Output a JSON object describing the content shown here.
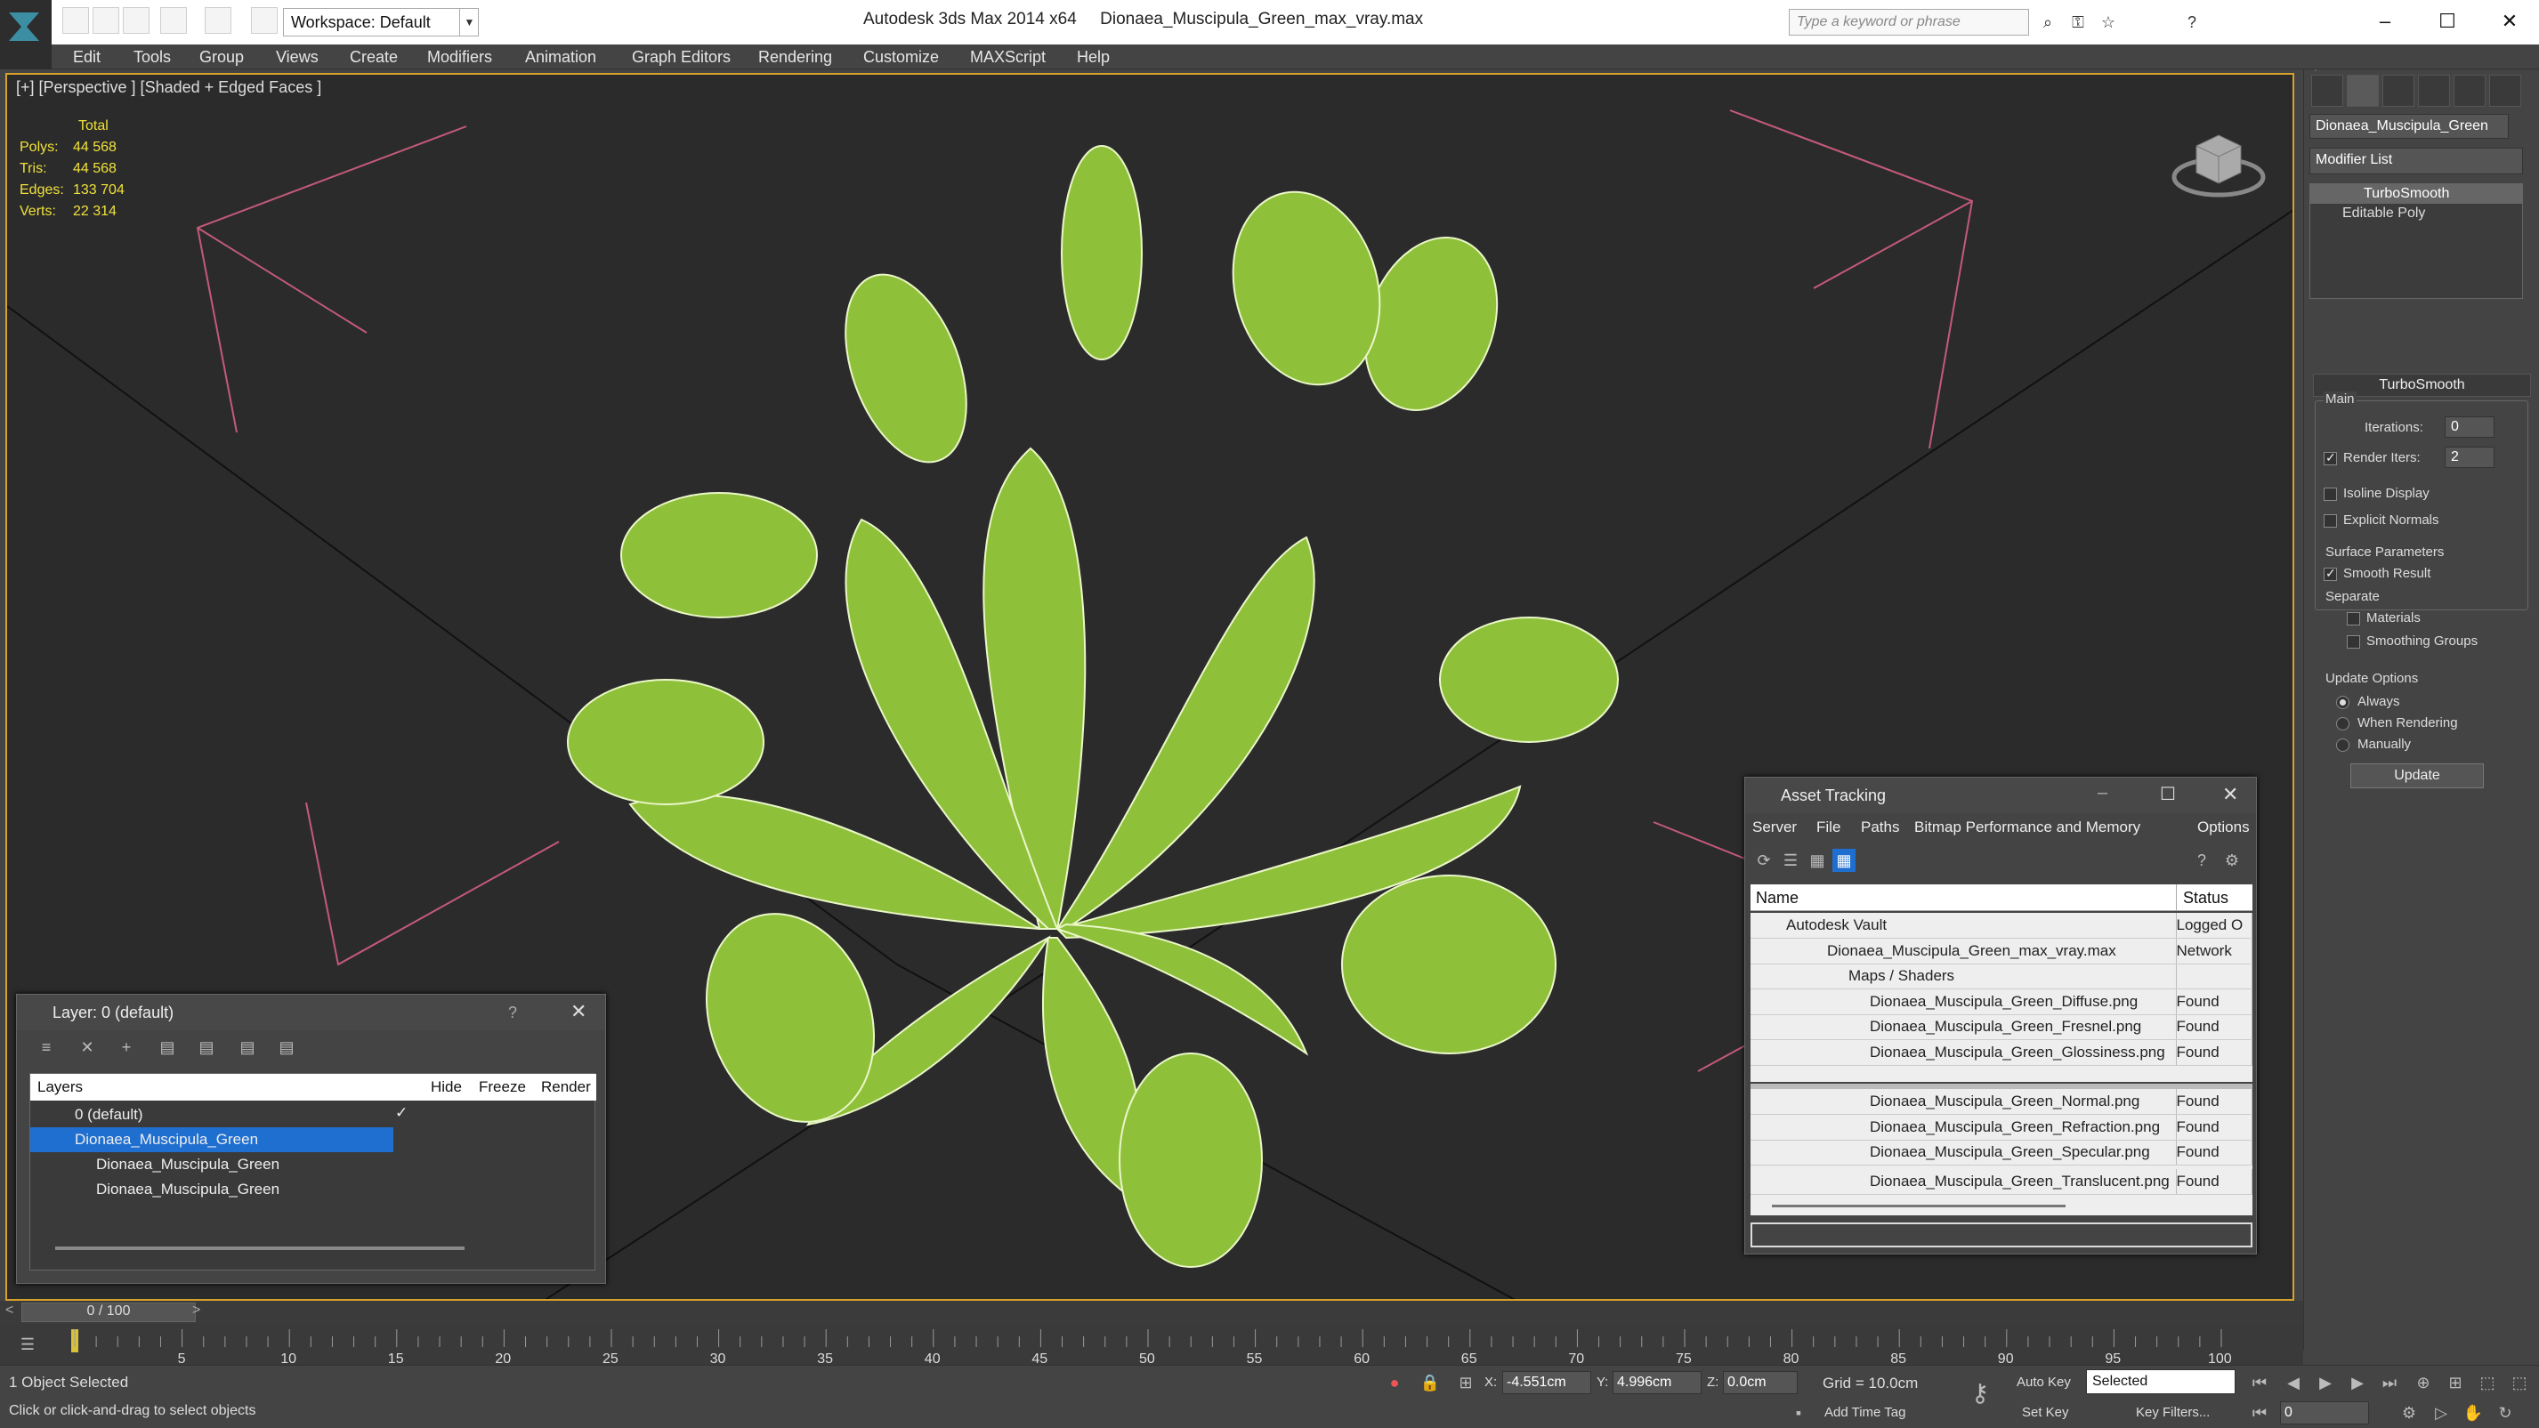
{
  "title": {
    "app": "Autodesk 3ds Max  2014 x64",
    "file": "Dionaea_Muscipula_Green_max_vray.max"
  },
  "workspace": "Workspace: Default",
  "search": {
    "placeholder": "Type a keyword or phrase"
  },
  "menu": [
    "Edit",
    "Tools",
    "Group",
    "Views",
    "Create",
    "Modifiers",
    "Animation",
    "Graph Editors",
    "Rendering",
    "Customize",
    "MAXScript",
    "Help"
  ],
  "viewport": {
    "label": "[+] [Perspective ] [Shaded + Edged Faces ]",
    "stats": {
      "header": "Total",
      "rows": [
        {
          "k": "Polys:",
          "v": "44 568"
        },
        {
          "k": "Tris:",
          "v": "44 568"
        },
        {
          "k": "Edges:",
          "v": "133 704"
        },
        {
          "k": "Verts:",
          "v": "22 314"
        }
      ]
    }
  },
  "command_panel": {
    "object_name": "Dionaea_Muscipula_Green",
    "modifier_list": "Modifier List",
    "stack": [
      "TurboSmooth",
      "Editable Poly"
    ],
    "rollout": "TurboSmooth",
    "main": "Main",
    "iterations_label": "Iterations:",
    "iterations": "0",
    "render_iters_label": "Render Iters:",
    "render_iters": "2",
    "isoline": "Isoline Display",
    "explicit_normals": "Explicit Normals",
    "surface_params": "Surface Parameters",
    "smooth_result": "Smooth Result",
    "separate": "Separate",
    "materials": "Materials",
    "smoothing_groups": "Smoothing Groups",
    "update_options": "Update Options",
    "always": "Always",
    "when_rendering": "When Rendering",
    "manually": "Manually",
    "update_btn": "Update"
  },
  "asset_tracking": {
    "title": "Asset Tracking",
    "menu": [
      "Server",
      "File",
      "Paths",
      "Bitmap Performance and Memory",
      "Options"
    ],
    "col_name": "Name",
    "col_status": "Status",
    "rows": [
      {
        "name": "Autodesk Vault",
        "status": "Logged O"
      },
      {
        "name": "Dionaea_Muscipula_Green_max_vray.max",
        "status": "Network"
      },
      {
        "name": "Maps / Shaders",
        "status": ""
      },
      {
        "name": "Dionaea_Muscipula_Green_Diffuse.png",
        "status": "Found"
      },
      {
        "name": "Dionaea_Muscipula_Green_Fresnel.png",
        "status": "Found"
      },
      {
        "name": "Dionaea_Muscipula_Green_Glossiness.png",
        "status": "Found"
      },
      {
        "name": "Dionaea_Muscipula_Green_Normal.png",
        "status": "Found"
      },
      {
        "name": "Dionaea_Muscipula_Green_Refraction.png",
        "status": "Found"
      },
      {
        "name": "Dionaea_Muscipula_Green_Specular.png",
        "status": "Found"
      },
      {
        "name": "Dionaea_Muscipula_Green_Translucent.png",
        "status": "Found"
      }
    ]
  },
  "layer_dialog": {
    "title": "Layer: 0 (default)",
    "help": "?",
    "col_layers": "Layers",
    "col_hide": "Hide",
    "col_freeze": "Freeze",
    "col_render": "Render",
    "rows": [
      "0 (default)",
      "Dionaea_Muscipula_Green",
      "Dionaea_Muscipula_Green",
      "Dionaea_Muscipula_Green"
    ]
  },
  "timeline": {
    "frame": "0 / 100",
    "ticks": [
      "5",
      "10",
      "15",
      "20",
      "25",
      "30",
      "35",
      "40",
      "45",
      "50",
      "55",
      "60",
      "65",
      "70",
      "75",
      "80",
      "85",
      "90",
      "95",
      "100"
    ]
  },
  "status": {
    "selected": "1 Object Selected",
    "prompt": "Click or click-and-drag to select objects",
    "x_label": "X:",
    "x": "-4.551cm",
    "y_label": "Y:",
    "y": "4.996cm",
    "z_label": "Z:",
    "z": "0.0cm",
    "grid": "Grid = 10.0cm",
    "add_time_tag": "Add Time Tag",
    "auto_key": "Auto Key",
    "set_key": "Set Key",
    "selected_dd": "Selected",
    "key_filters": "Key Filters...",
    "frame_field": "0"
  },
  "colors": {
    "accent": "#d7a12a",
    "selection": "#1f6fd1",
    "plant": "#8fc03a"
  }
}
